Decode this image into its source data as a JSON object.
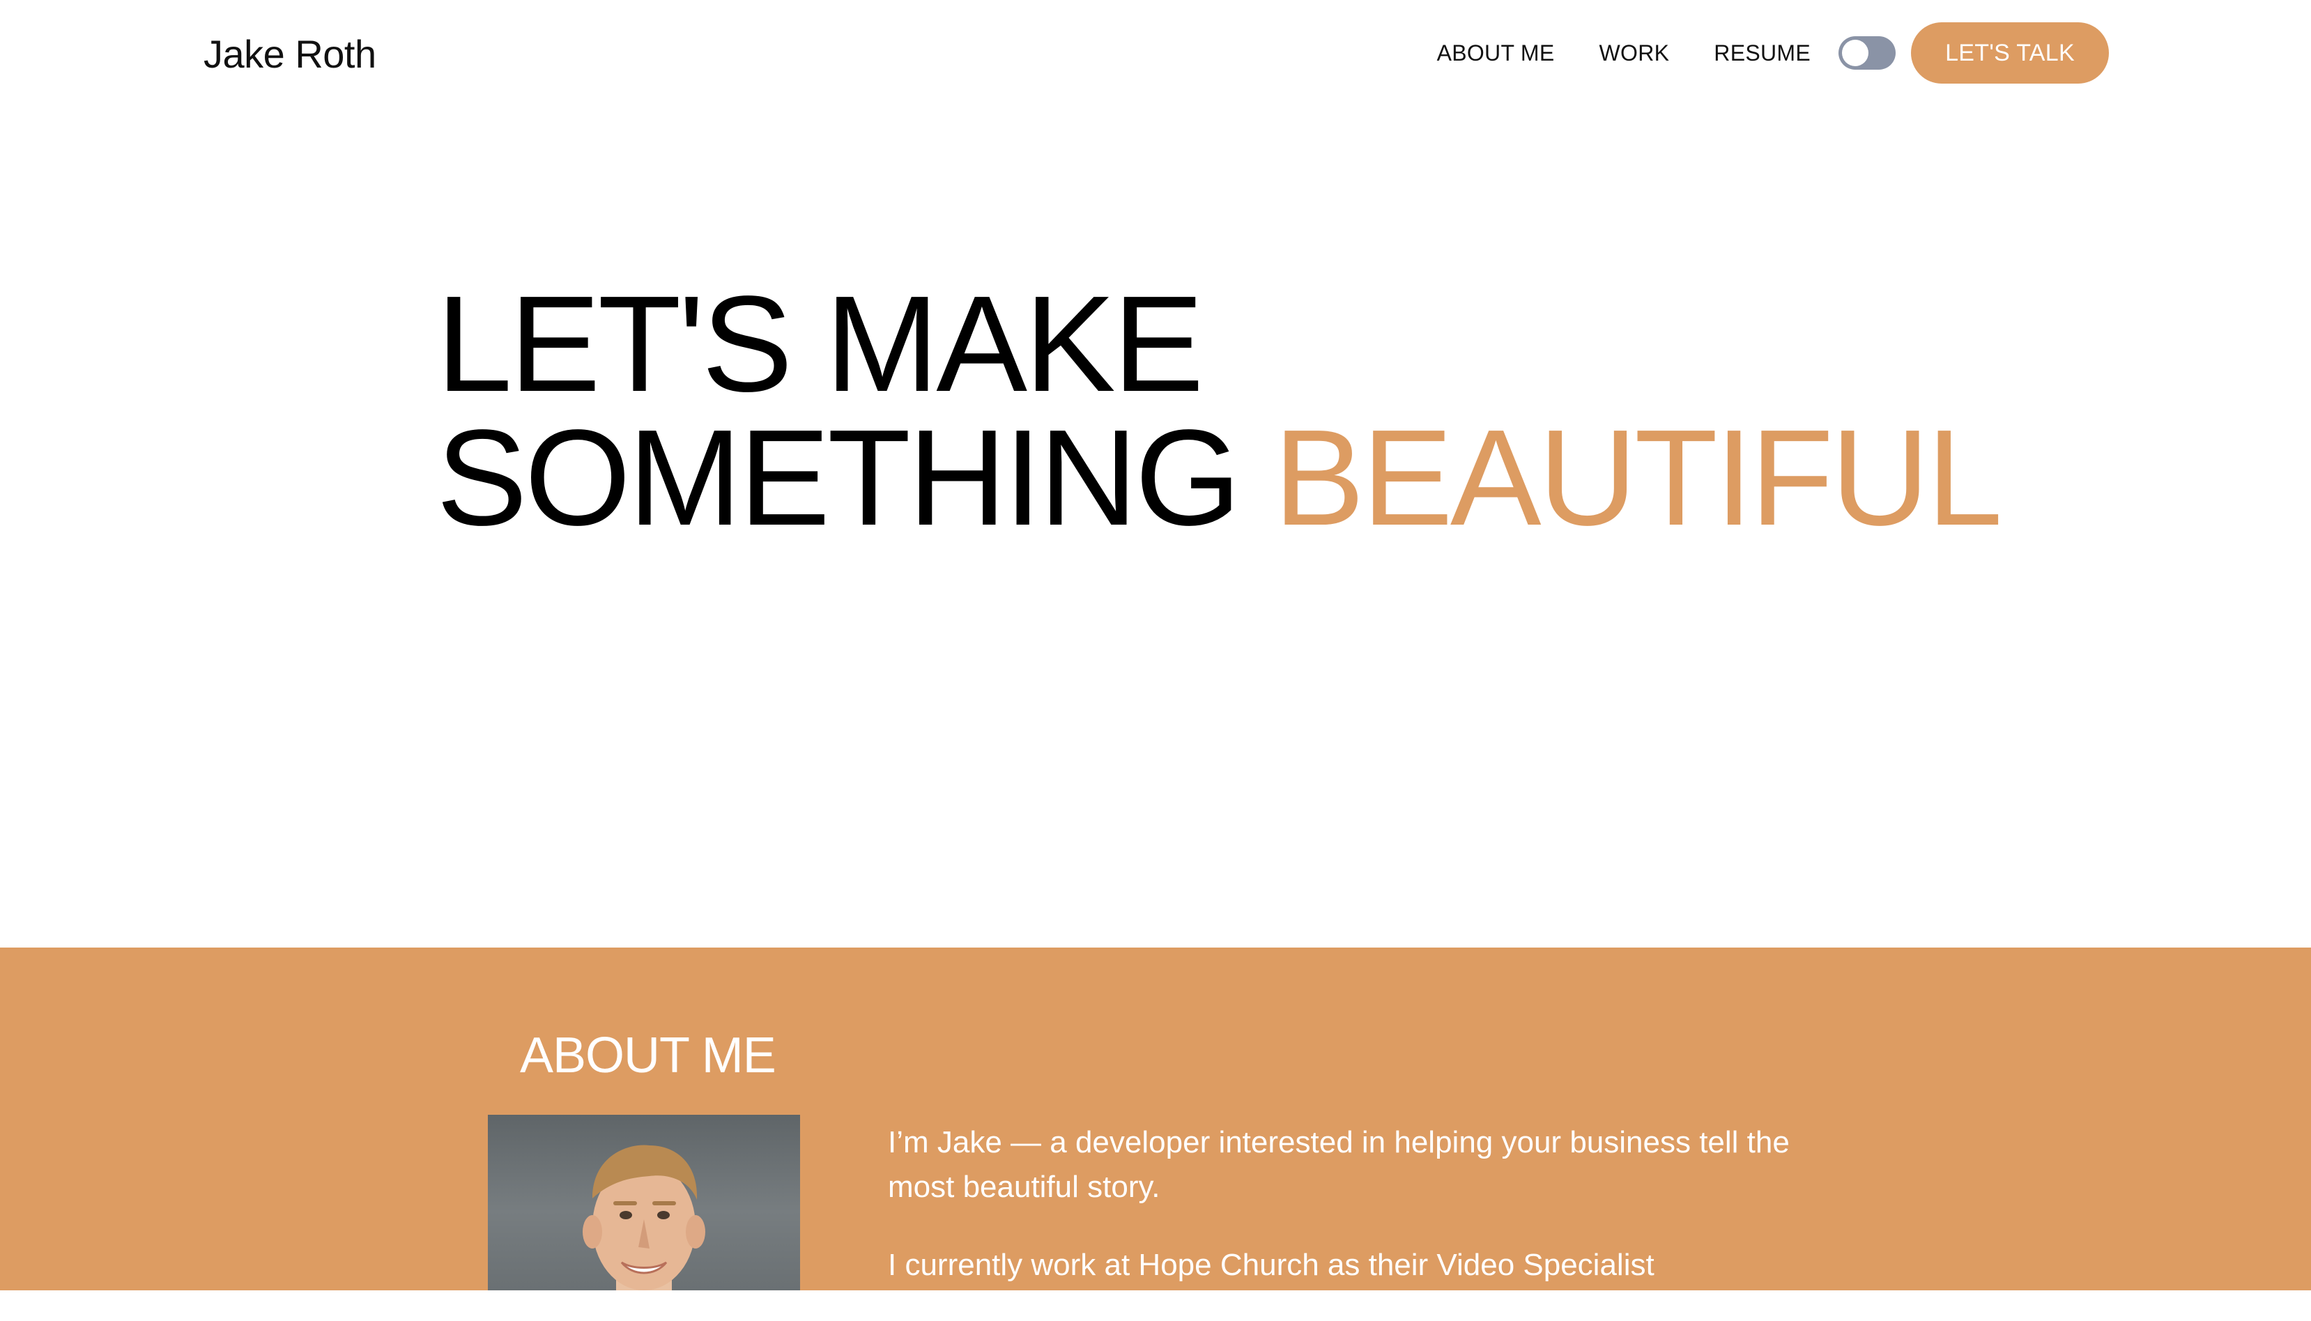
{
  "header": {
    "brand": "Jake Roth",
    "nav": [
      "ABOUT ME",
      "WORK",
      "RESUME"
    ],
    "cta_label": "LET'S TALK"
  },
  "hero": {
    "line1": "LET'S MAKE",
    "line2_plain": "SOMETHING",
    "line2_accent": "BEAUTIFUL"
  },
  "about": {
    "title": "ABOUT ME",
    "paragraphs": [
      "I’m Jake — a developer interested in helping your business tell the most beautiful story.",
      "I currently work at Hope Church as their Video Specialist"
    ]
  },
  "colors": {
    "accent": "#dd9c62",
    "toggle_track": "#8a93a6",
    "text": "#000000"
  },
  "icons": {
    "theme_toggle": "toggle-switch"
  }
}
